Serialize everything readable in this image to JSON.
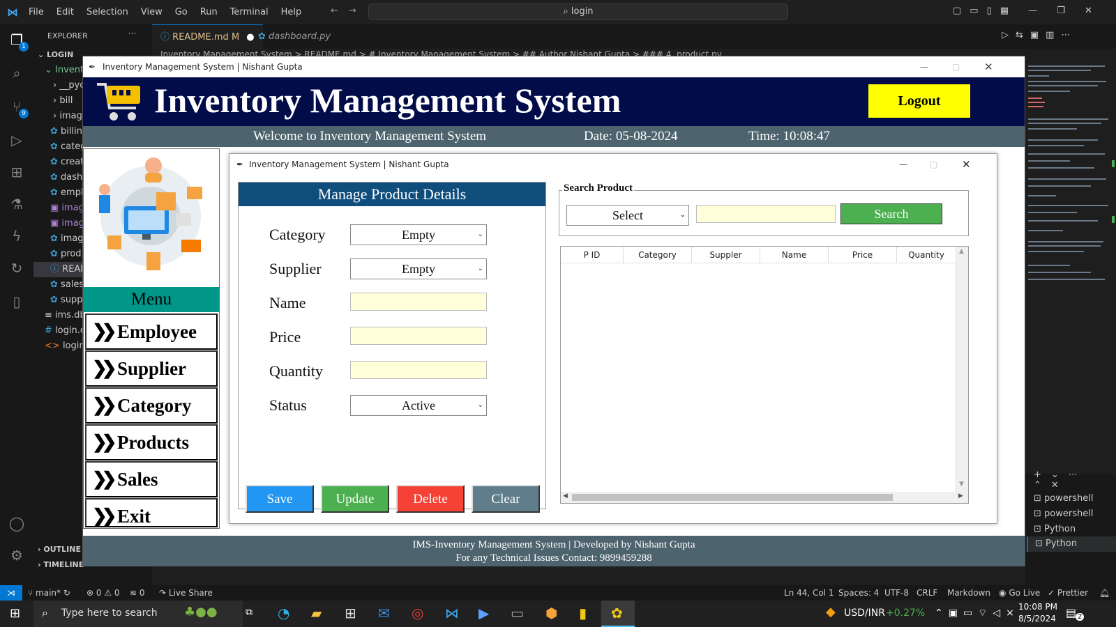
{
  "vscode": {
    "menu": [
      "File",
      "Edit",
      "Selection",
      "View",
      "Go",
      "Run",
      "Terminal",
      "Help"
    ],
    "command_center": "login",
    "explorer_title": "EXPLORER",
    "workspace": "LOGIN",
    "tree": [
      "Invent",
      "__pyc",
      "bill",
      "imag",
      "billin",
      "categ",
      "creat",
      "dash",
      "empl",
      "imag",
      "imag",
      "imag",
      "prod",
      "READ",
      "sales",
      "supp",
      "ims.db",
      "login.c",
      "login.h"
    ],
    "outline": "OUTLINE",
    "timeline": "TIMELINE",
    "tabs": [
      {
        "label": "README.md",
        "badge": "M"
      },
      {
        "label": "dashboard.py"
      }
    ],
    "breadcrumb": "Inventory Management System > README.md > # Inventory Management System > ## Author Nishant Gupta > ### 4. product.py",
    "explorer_badge": "1",
    "scm_badge": "9",
    "terminals": [
      "powershell",
      "powershell",
      "Python",
      "Python"
    ]
  },
  "statusbar": {
    "branch": "main*",
    "problems": "⊗ 0 ⚠ 0",
    "ports": "0",
    "live_share": "Live Share",
    "position": "Ln 44, Col 1",
    "spaces": "Spaces: 4",
    "encoding": "UTF-8",
    "eol": "CRLF",
    "language": "Markdown",
    "go_live": "Go Live",
    "prettier": "Prettier"
  },
  "taskbar": {
    "search_placeholder": "Type here to search",
    "ticker_label": "USD/INR",
    "ticker_change": "+0.27%",
    "time": "10:08 PM",
    "date": "8/5/2024",
    "notifications": "2"
  },
  "ims": {
    "window_title": "Inventory Management System | Nishant Gupta",
    "header_title": "Inventory Management System",
    "logout_label": "Logout",
    "welcome": "Welcome to Inventory Management System",
    "date": "Date: 05-08-2024",
    "time": "Time: 10:08:47",
    "menu_title": "Menu",
    "menu_items": [
      "Employee",
      "Supplier",
      "Category",
      "Products",
      "Sales",
      "Exit"
    ],
    "footer_line1": "IMS-Inventory Management System | Developed by Nishant Gupta",
    "footer_line2": "For any Technical Issues Contact: 9899459288",
    "colors": {
      "header_bg": "#010c48",
      "logout_bg": "#ffff00",
      "teal": "#009688",
      "slate": "#4d636d"
    }
  },
  "product": {
    "window_title": "Inventory Management System | Nishant Gupta",
    "panel_title": "Manage Product Details",
    "fields": {
      "category_label": "Category",
      "category_value": "Empty",
      "supplier_label": "Supplier",
      "supplier_value": "Empty",
      "name_label": "Name",
      "name_value": "",
      "price_label": "Price",
      "price_value": "",
      "quantity_label": "Quantity",
      "quantity_value": "",
      "status_label": "Status",
      "status_value": "Active"
    },
    "buttons": {
      "save": "Save",
      "update": "Update",
      "delete": "Delete",
      "clear": "Clear"
    },
    "button_colors": {
      "save": "#2196f3",
      "update": "#4caf50",
      "delete": "#f44336",
      "clear": "#607d8b"
    },
    "search_group": "Search Product",
    "search_by": "Select",
    "search_text": "",
    "search_button": "Search",
    "table_columns": [
      "P ID",
      "Category",
      "Suppler",
      "Name",
      "Price",
      "Quantity"
    ],
    "table_rows": []
  }
}
